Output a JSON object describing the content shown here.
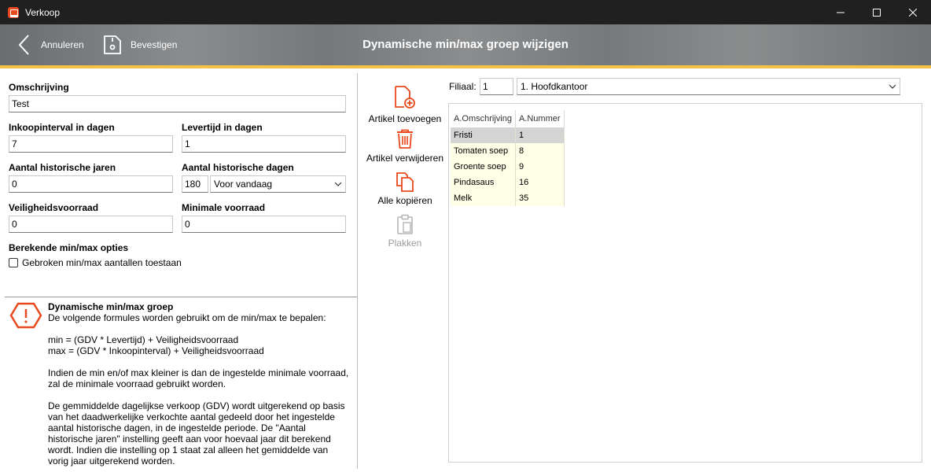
{
  "window": {
    "app_title": "Verkoop"
  },
  "header": {
    "cancel_label": "Annuleren",
    "confirm_label": "Bevestigen",
    "title": "Dynamische min/max groep wijzigen"
  },
  "form": {
    "omschrijving_label": "Omschrijving",
    "omschrijving_value": "Test",
    "inkoopinterval_label": "Inkoopinterval in dagen",
    "inkoopinterval_value": "7",
    "levertijd_label": "Levertijd in dagen",
    "levertijd_value": "1",
    "hist_jaren_label": "Aantal historische jaren",
    "hist_jaren_value": "0",
    "hist_dagen_label": "Aantal historische dagen",
    "hist_dagen_value": "180",
    "hist_dagen_option": "Voor vandaag",
    "veiligheid_label": "Veiligheidsvoorraad",
    "veiligheid_value": "0",
    "minimale_label": "Minimale voorraad",
    "minimale_value": "0",
    "opties_label": "Berekende min/max opties",
    "gebroken_label": "Gebroken min/max aantallen toestaan"
  },
  "info": {
    "title": "Dynamische min/max groep",
    "body": "De volgende formules worden gebruikt om de min/max te bepalen:\n\nmin = (GDV * Levertijd) + Veiligheidsvoorraad\nmax = (GDV * Inkoopinterval) + Veiligheidsvoorraad\n\nIndien de min en/of max kleiner is dan de ingestelde minimale voorraad, zal de minimale voorraad gebruikt worden.\n\nDe gemmiddelde dagelijkse verkoop (GDV) wordt uitgerekend op basis van het daadwerkelijke verkochte aantal gedeeld door het ingestelde aantal historische dagen, in de ingestelde periode. De \"Aantal historische jaren\" instelling geeft aan voor hoevaal jaar dit berekend wordt. Indien die instelling op 1 staat zal alleen het gemiddelde van vorig jaar uitgerekend worden."
  },
  "toolbar": {
    "add_label": "Artikel toevoegen",
    "remove_label": "Artikel verwijderen",
    "copy_label": "Alle kopiëren",
    "paste_label": "Plakken"
  },
  "filiaal": {
    "label": "Filiaal:",
    "number": "1",
    "selected": "1. Hoofdkantoor"
  },
  "grid": {
    "headers": [
      "A.Omschrijving",
      "A.Nummer"
    ],
    "rows": [
      [
        "Fristi",
        "1"
      ],
      [
        "Tomaten soep",
        "8"
      ],
      [
        "Groente soep",
        "9"
      ],
      [
        "Pindasaus",
        "16"
      ],
      [
        "Melk",
        "35"
      ]
    ]
  },
  "colors": {
    "accent": "#e8491d",
    "header_stripe": "#f5c244"
  }
}
